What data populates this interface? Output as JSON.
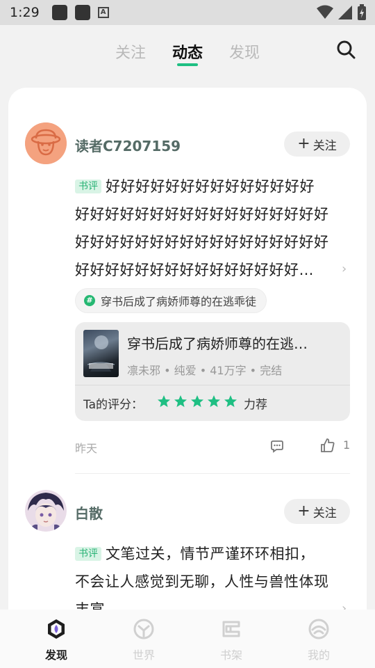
{
  "status_bar": {
    "time": "1:29"
  },
  "top_tabs": [
    {
      "label": "关注"
    },
    {
      "label": "动态"
    },
    {
      "label": "发现"
    }
  ],
  "posts": [
    {
      "username": "读者C7207159",
      "follow_label": "关注",
      "tag": "书评",
      "review_lines": [
        "好好好好好好好好好好好好好好",
        "好好好好好好好好好好好好好好好好好",
        "好好好好好好好好好好好好好好好好好",
        "好好好好好好好好好好好好好好好…"
      ],
      "topic": "穿书后成了病娇师尊的在逃乖徒",
      "book": {
        "title": "穿书后成了病娇师尊的在逃…",
        "meta": "凛未邪 • 纯爱 • 41万字 • 完结"
      },
      "rating_label": "Ta的评分：",
      "rating_stars": 5,
      "rating_word": "力荐",
      "date": "昨天",
      "like_count": "1"
    },
    {
      "username": "白散",
      "follow_label": "关注",
      "tag": "书评",
      "review_lines": [
        "文笔过关，情节严谨环环相扣，",
        "不会让人感觉到无聊，人性与兽性体现",
        "丰富"
      ]
    }
  ],
  "bottom_nav": [
    {
      "label": "发现",
      "icon": "discover-icon",
      "active": true
    },
    {
      "label": "世界",
      "icon": "world-icon",
      "active": false
    },
    {
      "label": "书架",
      "icon": "bookshelf-icon",
      "active": false
    },
    {
      "label": "我的",
      "icon": "profile-icon",
      "active": false
    }
  ],
  "colors": {
    "accent": "#1fbf83",
    "tag_bg": "#d9f4e6",
    "tag_text": "#27b274",
    "username": "#556b66"
  }
}
